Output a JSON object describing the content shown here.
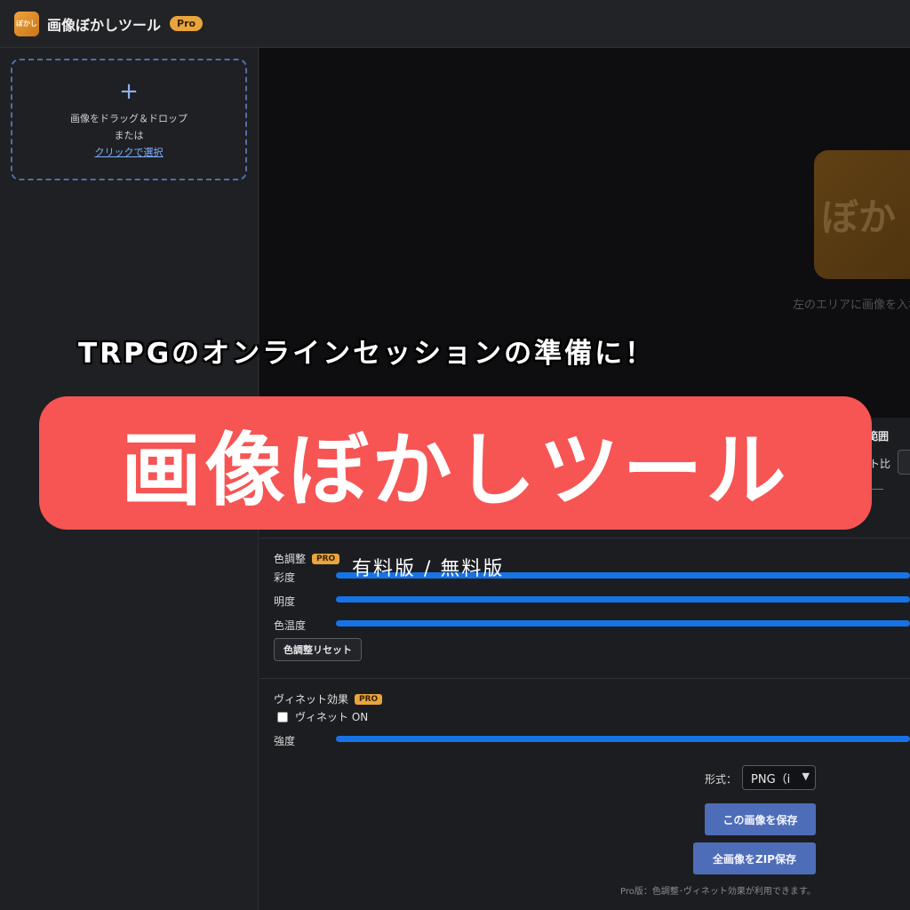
{
  "header": {
    "logo_text": "ぼかし",
    "title": "画像ぼかしツール",
    "badge": "Pro"
  },
  "sidebar": {
    "dropzone": {
      "plus": "+",
      "line1": "画像をドラッグ＆ドロップ",
      "line2": "または",
      "link": "クリックで選択"
    }
  },
  "preview": {
    "logo_text": "ぼか",
    "hint": "左のエリアに画像を入れ"
  },
  "controls": {
    "range_label": "範囲",
    "aspect_label": "ト比",
    "color_adjust": {
      "title": "色調整",
      "badge": "PRO",
      "sliders": [
        "彩度",
        "明度",
        "色温度"
      ],
      "reset": "色調整リセット"
    },
    "vignette": {
      "title": "ヴィネット効果",
      "badge": "PRO",
      "checkbox_label": "ヴィネット ON",
      "strength": "強度"
    },
    "format": {
      "label": "形式：",
      "selected": "PNG（i"
    },
    "save_button": "この画像を保存",
    "zip_button": "全画像をZIP保存",
    "footnote": "Pro版：色調整･ヴィネット効果が利用できます。"
  },
  "overlay": {
    "tagline": "TRPGのオンラインセッションの準備に！",
    "banner": "画像ぼかしツール",
    "caption": "有料版 / 無料版"
  },
  "colors": {
    "accent_blue": "#1673e6",
    "button_blue": "#4e6db8",
    "pro_orange": "#e9a43c",
    "banner_red": "#f75454"
  }
}
